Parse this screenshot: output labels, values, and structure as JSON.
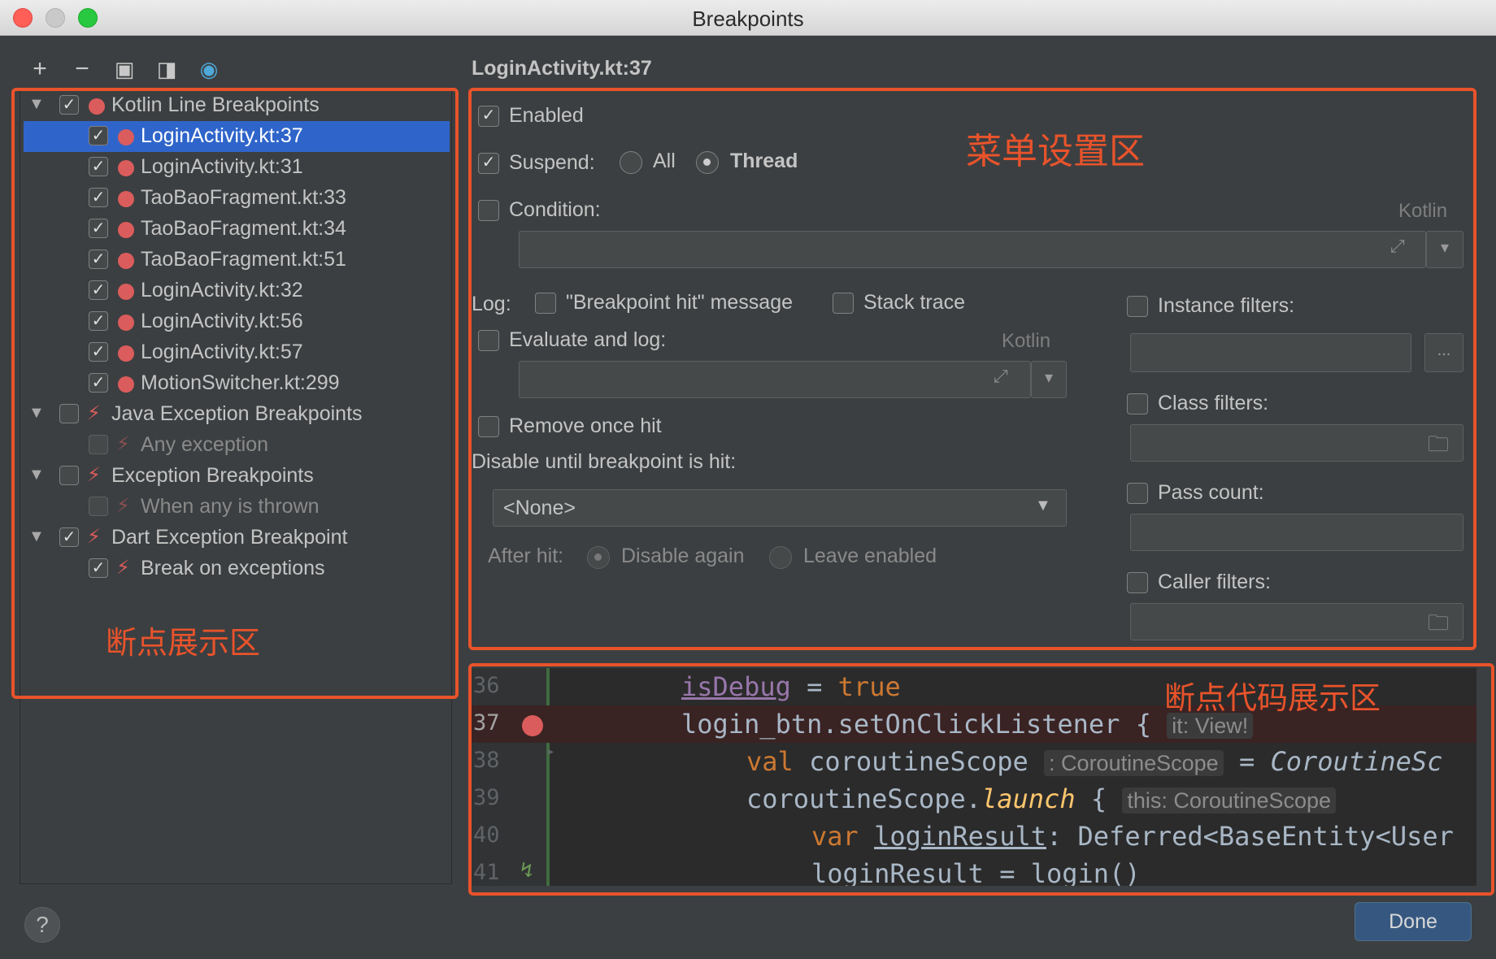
{
  "window": {
    "title": "Breakpoints"
  },
  "toolbar": {
    "add": "+",
    "remove": "−",
    "group": "▣",
    "export": "◨",
    "import": "◉"
  },
  "tree": {
    "kotlin_group": "Kotlin Line Breakpoints",
    "items": [
      "LoginActivity.kt:37",
      "LoginActivity.kt:31",
      "TaoBaoFragment.kt:33",
      "TaoBaoFragment.kt:34",
      "TaoBaoFragment.kt:51",
      "LoginActivity.kt:32",
      "LoginActivity.kt:56",
      "LoginActivity.kt:57",
      "MotionSwitcher.kt:299"
    ],
    "java_group": "Java Exception Breakpoints",
    "java_item": "Any exception",
    "exception_group": "Exception Breakpoints",
    "exception_item": "When any is thrown",
    "dart_group": "Dart Exception Breakpoint",
    "dart_item": "Break on exceptions"
  },
  "annotations": {
    "tree_area": "断点展示区",
    "settings_area": "菜单设置区",
    "code_area": "断点代码展示区"
  },
  "detail": {
    "title": "LoginActivity.kt:37",
    "enabled": "Enabled",
    "suspend": "Suspend:",
    "suspend_all": "All",
    "suspend_thread": "Thread",
    "condition": "Condition:",
    "lang": "Kotlin",
    "log": "Log:",
    "log_message": "\"Breakpoint hit\" message",
    "stack_trace": "Stack trace",
    "evaluate_log": "Evaluate and log:",
    "remove_once": "Remove once hit",
    "disable_until": "Disable until breakpoint is hit:",
    "disable_select": "<None>",
    "after_hit": "After hit:",
    "disable_again": "Disable again",
    "leave_enabled": "Leave enabled",
    "instance_filters": "Instance filters:",
    "more_btn": "...",
    "class_filters": "Class filters:",
    "pass_count": "Pass count:",
    "caller_filters": "Caller filters:"
  },
  "code": {
    "line_numbers": [
      "36",
      "37",
      "38",
      "39",
      "40",
      "41"
    ],
    "l36_prop": "isDebug",
    "l36_rest": " = ",
    "l36_val": "true",
    "l37_code": "login_btn.setOnClickListener {",
    "l37_hint": "it: View!",
    "l38_kw": "val",
    "l38_name": " coroutineScope",
    "l38_hint": ": CoroutineScope",
    "l38_rest": " = ",
    "l38_it": "CoroutineSc",
    "l39_a": "coroutineScope.",
    "l39_fn": "launch",
    "l39_b": " {",
    "l39_hint": "this: CoroutineScope",
    "l40_kw": "var",
    "l40_name": "loginResult",
    "l40_rest": ": Deferred<BaseEntity<User",
    "l41": "loginResult = login()"
  },
  "footer": {
    "help": "?",
    "done": "Done"
  },
  "colors": {
    "accent": "#2f65ca",
    "annotation": "#e9532b",
    "breakpoint": "#db5c5c"
  }
}
